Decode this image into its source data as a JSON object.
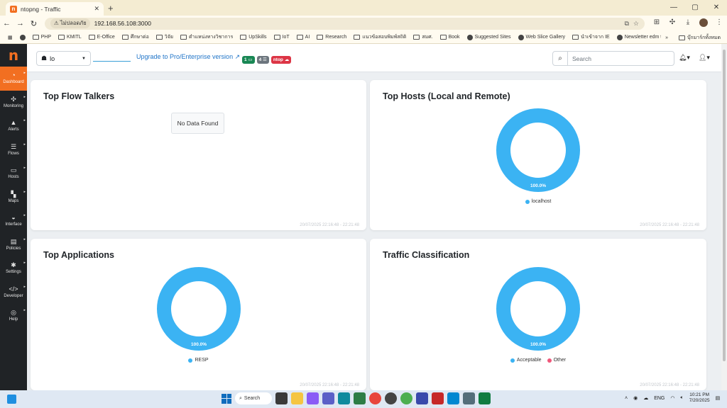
{
  "browser": {
    "tab_title": "ntopng - Traffic",
    "tab_close": "✕",
    "new_tab": "+",
    "security_label": "ไม่ปลอดภัย",
    "url": "192.168.56.108:3000",
    "window_controls": [
      "—",
      "▢",
      "✕"
    ],
    "bookmarks": [
      "PHP",
      "KMITL",
      "E-Office",
      "ศึกษาต่อ",
      "วิจัย",
      "ตำแหน่งทางวิชาการ",
      "UpSkills",
      "IoT",
      "AI",
      "Research",
      "แนวข้อสอบพิมพ์สถิติ",
      "สมศ.",
      "Book",
      "Suggested Sites",
      "Web Slice Gallery",
      "นำเข้าจาก IE",
      "Newsletter edm te..."
    ],
    "bookmarks_more": "»",
    "bookmarks_other": "บุ๊กมาร์กทั้งหมด"
  },
  "sidebar": {
    "logo": "n",
    "items": [
      {
        "label": "Dashboard",
        "icon": "gauge-icon",
        "glyph": "◔"
      },
      {
        "label": "Monitoring",
        "icon": "heartbeat-icon",
        "glyph": "✣"
      },
      {
        "label": "Alerts",
        "icon": "warning-icon",
        "glyph": "▲"
      },
      {
        "label": "Flows",
        "icon": "stream-icon",
        "glyph": "☰"
      },
      {
        "label": "Hosts",
        "icon": "laptop-icon",
        "glyph": "▭"
      },
      {
        "label": "Maps",
        "icon": "map-icon",
        "glyph": "▚"
      },
      {
        "label": "Interface",
        "icon": "ethernet-icon",
        "glyph": "◒"
      },
      {
        "label": "Policies",
        "icon": "book-icon",
        "glyph": "▤"
      },
      {
        "label": "Settings",
        "icon": "gear-icon",
        "glyph": "✱"
      },
      {
        "label": "Developer",
        "icon": "code-icon",
        "glyph": "</>"
      },
      {
        "label": "Help",
        "icon": "life-ring-icon",
        "glyph": "◎"
      }
    ]
  },
  "header": {
    "interface_name": "lo",
    "upgrade_text": "Upgrade to Pro/Enterprise version",
    "badges": [
      "1 ▭",
      "4 ☰",
      "ntop ☁"
    ],
    "search_placeholder": "Search"
  },
  "cards": {
    "flow_talkers": {
      "title": "Top Flow Talkers",
      "no_data": "No Data Found",
      "stamp": "20/07/2025 22:16:48 - 22:21:48"
    },
    "top_hosts": {
      "title": "Top Hosts (Local and Remote)",
      "stamp": "20/07/2025 22:16:48 - 22:21:48"
    },
    "top_apps": {
      "title": "Top Applications",
      "stamp": "20/07/2025 22:16:48 - 22:21:48"
    },
    "traffic_class": {
      "title": "Traffic Classification",
      "stamp": "20/07/2025 22:16:48 - 22:21:48"
    }
  },
  "chart_data": [
    {
      "type": "pie",
      "title": "Top Hosts (Local and Remote)",
      "categories": [
        "localhost"
      ],
      "values": [
        100.0
      ],
      "label": "100.0%",
      "colors": [
        "#3bb3f3"
      ]
    },
    {
      "type": "pie",
      "title": "Top Applications",
      "categories": [
        "RESP"
      ],
      "values": [
        100.0
      ],
      "label": "100.0%",
      "colors": [
        "#3bb3f3"
      ]
    },
    {
      "type": "pie",
      "title": "Traffic Classification",
      "categories": [
        "Acceptable",
        "Other"
      ],
      "values": [
        100.0,
        0.0
      ],
      "label": "100.0%",
      "colors": [
        "#3bb3f3",
        "#f0577a"
      ]
    }
  ],
  "taskbar": {
    "search_label": "Search",
    "lang": "ENG",
    "time": "10:21 PM",
    "date": "7/20/2025"
  }
}
